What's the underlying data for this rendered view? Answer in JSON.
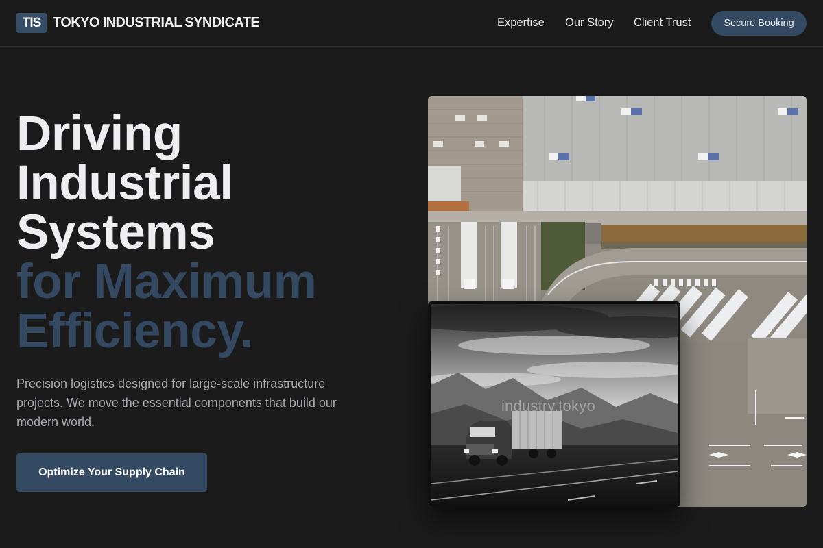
{
  "header": {
    "logo_badge": "TIS",
    "brand_name": "TOKYO INDUSTRIAL SYNDICATE",
    "nav_links": [
      "Expertise",
      "Our Story",
      "Client Trust"
    ],
    "cta_label": "Secure Booking"
  },
  "hero": {
    "headline_light": [
      "Driving",
      "Industrial",
      "Systems"
    ],
    "headline_accent": [
      "for Maximum",
      "Efficiency."
    ],
    "lead": "Precision logistics designed for large-scale infrastructure projects. We move the essential components that build our modern world.",
    "cta_label": "Optimize Your Supply Chain"
  },
  "images": {
    "truck_watermark": "industry.tokyo"
  },
  "colors": {
    "background": "#1b1b1c",
    "accent": "#344a63",
    "headline_accent": "#344961",
    "body_text": "#a9a9ae"
  }
}
